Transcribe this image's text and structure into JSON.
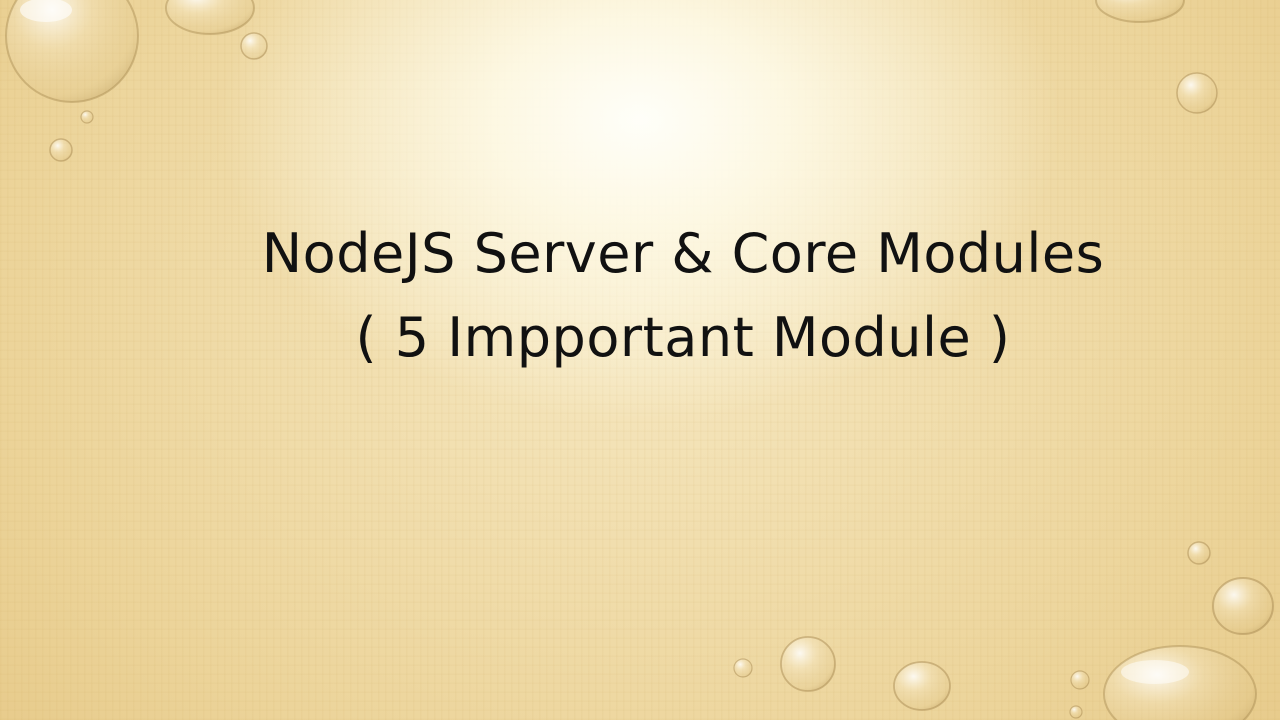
{
  "slide": {
    "title_line_1": "NodeJS Server & Core Modules",
    "title_line_2": "( 5 Impportant Module )"
  },
  "colors": {
    "background": "#ecd49a",
    "highlight": "#fffdf4",
    "text": "#111111"
  }
}
